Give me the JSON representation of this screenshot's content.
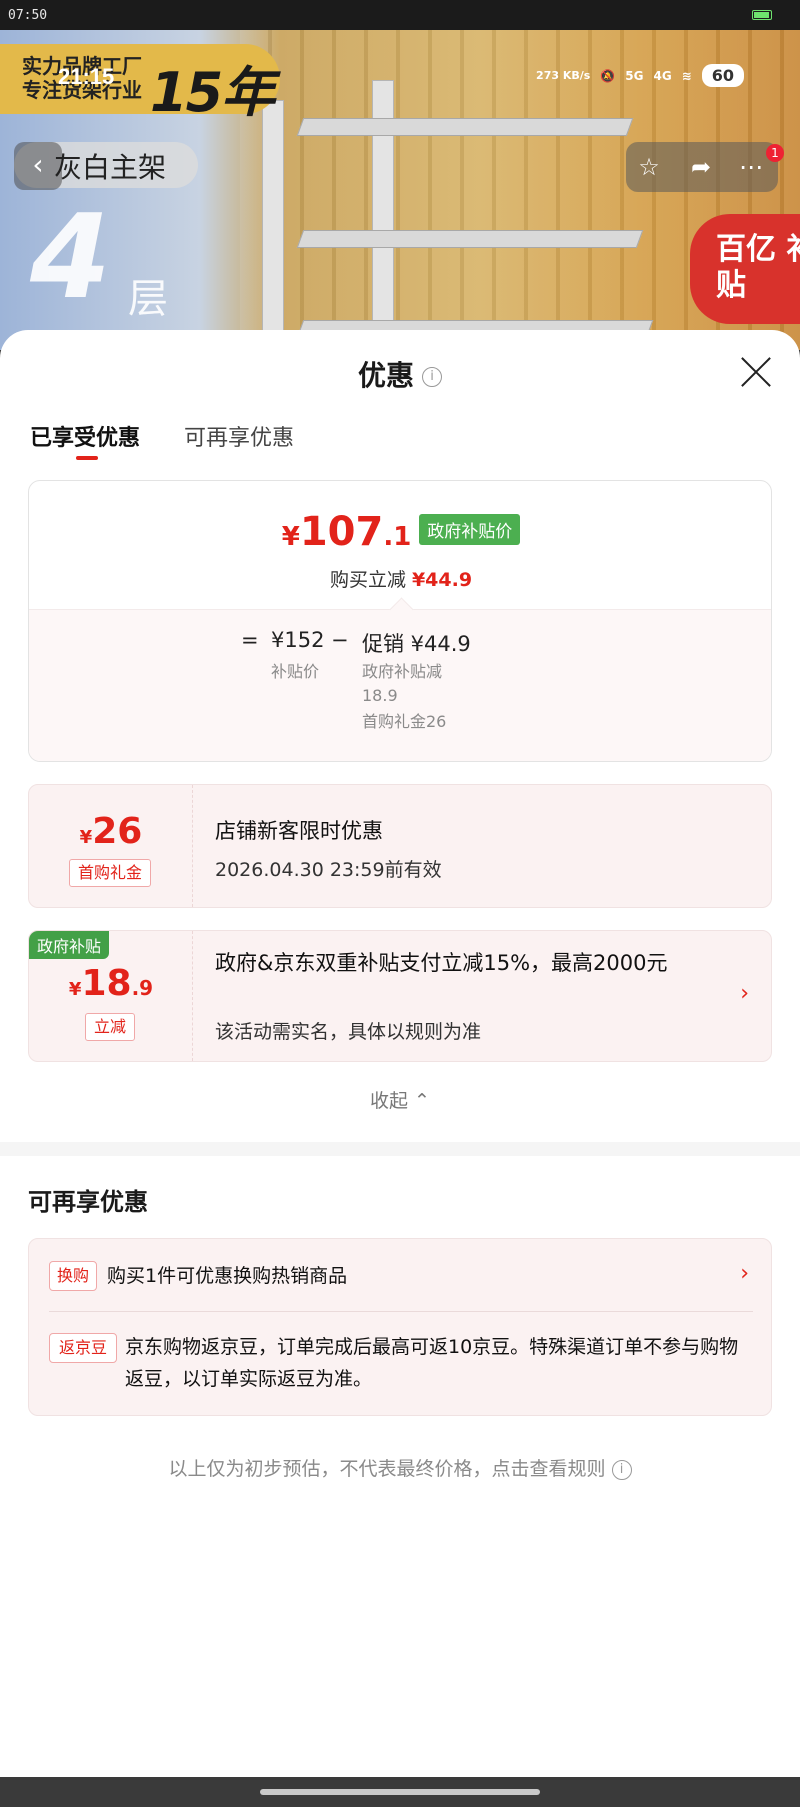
{
  "system": {
    "clock": "07:50"
  },
  "product_header": {
    "banner_text": "实力品牌工厂 专注货架行业",
    "banner_years": "15年",
    "status_time": "21:15",
    "net_speed": "273 KB/s",
    "signal_5g": "5G",
    "signal_4g": "4G",
    "battery_level": "60",
    "back_label": "灰白主架",
    "layers_number": "4",
    "layers_unit": "层",
    "notification_count": "1",
    "subsidy_badge": "百亿 补贴"
  },
  "sheet": {
    "title": "优惠",
    "tabs": [
      {
        "label": "已享受优惠",
        "active": true
      },
      {
        "label": "可再享优惠",
        "active": false
      }
    ],
    "price": {
      "currency": "¥",
      "integer": "107",
      "decimal": ".1",
      "tag": "政府补贴价",
      "cut_label": "购买立减",
      "cut_value": "¥44.9",
      "eq": "=",
      "base_price": "¥152",
      "base_label": "补贴价",
      "minus": "−",
      "promo": "促销 ¥44.9",
      "promo_detail_1": "政府补贴减",
      "promo_detail_2": "18.9",
      "promo_detail_3": "首购礼金26"
    },
    "coupons": [
      {
        "currency": "¥",
        "amount": "26",
        "decimal": "",
        "chip": "首购礼金",
        "title": "店铺新客限时优惠",
        "subtitle": "2026.04.30 23:59前有效"
      },
      {
        "tag": "政府补贴",
        "currency": "¥",
        "amount": "18",
        "decimal": ".9",
        "chip": "立减",
        "title": "政府&京东双重补贴支付立减15%，最高2000元",
        "subtitle": "该活动需实名，具体以规则为准"
      }
    ],
    "collapse_label": "收起 ⌃",
    "more_section_title": "可再享优惠",
    "more_items": [
      {
        "chip": "换购",
        "text": "购买1件可优惠换购热销商品"
      },
      {
        "chip": "返京豆",
        "text": "京东购物返京豆，订单完成后最高可返10京豆。特殊渠道订单不参与购物返豆，以订单实际返豆为准。"
      }
    ],
    "disclaimer": "以上仅为初步预估，不代表最终价格，点击查看规则"
  },
  "colors": {
    "accent": "#e2231a",
    "gov_green": "#4caf50"
  }
}
